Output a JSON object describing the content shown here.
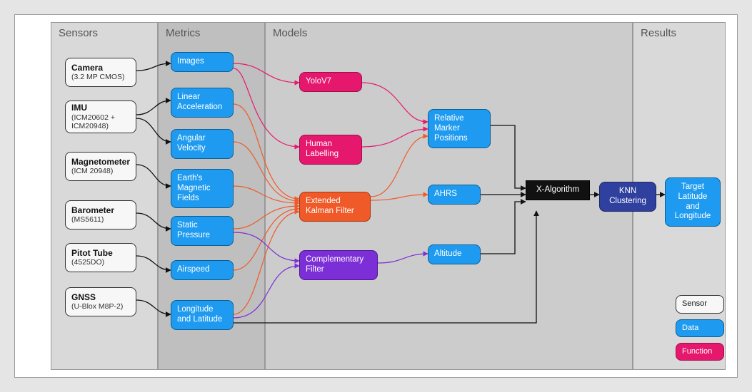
{
  "columns": {
    "sensors": "Sensors",
    "metrics": "Metrics",
    "models": "Models",
    "results": "Results"
  },
  "sensors": [
    {
      "title": "Camera",
      "sub": "(3.2 MP CMOS)"
    },
    {
      "title": "IMU",
      "sub": "(ICM20602 + ICM20948)"
    },
    {
      "title": "Magnetometer",
      "sub": "(ICM 20948)"
    },
    {
      "title": "Barometer",
      "sub": "(MS5611)"
    },
    {
      "title": "Pitot Tube",
      "sub": "(4525DO)"
    },
    {
      "title": "GNSS",
      "sub": "(U-Blox M8P-2)"
    }
  ],
  "metrics": [
    "Images",
    "Linear Acceleration",
    "Angular Velocity",
    "Earth's Magnetic Fields",
    "Static Pressure",
    "Airspeed",
    "Longitude and Latitude"
  ],
  "models": {
    "yolo": "YoloV7",
    "human": "Human Labelling",
    "ekf": "Extended Kalman Filter",
    "comp": "Complementary Filter",
    "rel": "Relative Marker Positions",
    "ahrs": "AHRS",
    "alt": "Altitude",
    "xalg": "X-Algorithm",
    "knn": "KNN Clustering"
  },
  "result": "Target Latitude and Longitude",
  "legend": {
    "sensor": "Sensor",
    "data": "Data",
    "function": "Function"
  },
  "chart_data": {
    "type": "table",
    "title": "Sensor fusion pipeline block diagram",
    "columns": [
      "Sensors",
      "Metrics",
      "Models",
      "Results"
    ],
    "nodes": [
      {
        "id": "camera",
        "label": "Camera (3.2 MP CMOS)",
        "kind": "sensor",
        "column": "Sensors"
      },
      {
        "id": "imu",
        "label": "IMU (ICM20602 + ICM20948)",
        "kind": "sensor",
        "column": "Sensors"
      },
      {
        "id": "mag",
        "label": "Magnetometer (ICM 20948)",
        "kind": "sensor",
        "column": "Sensors"
      },
      {
        "id": "baro",
        "label": "Barometer (MS5611)",
        "kind": "sensor",
        "column": "Sensors"
      },
      {
        "id": "pitot",
        "label": "Pitot Tube (4525DO)",
        "kind": "sensor",
        "column": "Sensors"
      },
      {
        "id": "gnss",
        "label": "GNSS (U-Blox M8P-2)",
        "kind": "sensor",
        "column": "Sensors"
      },
      {
        "id": "images",
        "label": "Images",
        "kind": "data",
        "column": "Metrics"
      },
      {
        "id": "linacc",
        "label": "Linear Acceleration",
        "kind": "data",
        "column": "Metrics"
      },
      {
        "id": "angvel",
        "label": "Angular Velocity",
        "kind": "data",
        "column": "Metrics"
      },
      {
        "id": "magf",
        "label": "Earth's Magnetic Fields",
        "kind": "data",
        "column": "Metrics"
      },
      {
        "id": "spress",
        "label": "Static Pressure",
        "kind": "data",
        "column": "Metrics"
      },
      {
        "id": "airspd",
        "label": "Airspeed",
        "kind": "data",
        "column": "Metrics"
      },
      {
        "id": "lonlat",
        "label": "Longitude and Latitude",
        "kind": "data",
        "column": "Metrics"
      },
      {
        "id": "yolo",
        "label": "YoloV7",
        "kind": "function",
        "column": "Models"
      },
      {
        "id": "human",
        "label": "Human Labelling",
        "kind": "function",
        "column": "Models"
      },
      {
        "id": "ekf",
        "label": "Extended Kalman Filter",
        "kind": "function",
        "column": "Models"
      },
      {
        "id": "comp",
        "label": "Complementary Filter",
        "kind": "function",
        "column": "Models"
      },
      {
        "id": "rel",
        "label": "Relative Marker Positions",
        "kind": "data",
        "column": "Models"
      },
      {
        "id": "ahrs",
        "label": "AHRS",
        "kind": "data",
        "column": "Models"
      },
      {
        "id": "alt",
        "label": "Altitude",
        "kind": "data",
        "column": "Models"
      },
      {
        "id": "xalg",
        "label": "X-Algorithm",
        "kind": "function",
        "column": "Models"
      },
      {
        "id": "knn",
        "label": "KNN Clustering",
        "kind": "function",
        "column": "Models"
      },
      {
        "id": "target",
        "label": "Target Latitude and Longitude",
        "kind": "data",
        "column": "Results"
      }
    ],
    "edges": [
      [
        "camera",
        "images"
      ],
      [
        "imu",
        "linacc"
      ],
      [
        "imu",
        "angvel"
      ],
      [
        "mag",
        "magf"
      ],
      [
        "baro",
        "spress"
      ],
      [
        "pitot",
        "airspd"
      ],
      [
        "gnss",
        "lonlat"
      ],
      [
        "images",
        "yolo"
      ],
      [
        "images",
        "human"
      ],
      [
        "linacc",
        "ekf"
      ],
      [
        "angvel",
        "ekf"
      ],
      [
        "magf",
        "ekf"
      ],
      [
        "spress",
        "ekf"
      ],
      [
        "airspd",
        "ekf"
      ],
      [
        "lonlat",
        "ekf"
      ],
      [
        "spress",
        "comp"
      ],
      [
        "lonlat",
        "comp"
      ],
      [
        "yolo",
        "rel"
      ],
      [
        "human",
        "rel"
      ],
      [
        "ekf",
        "ahrs"
      ],
      [
        "ekf",
        "rel"
      ],
      [
        "comp",
        "alt"
      ],
      [
        "rel",
        "xalg"
      ],
      [
        "ahrs",
        "xalg"
      ],
      [
        "alt",
        "xalg"
      ],
      [
        "lonlat",
        "xalg"
      ],
      [
        "xalg",
        "knn"
      ],
      [
        "knn",
        "target"
      ]
    ],
    "legend": [
      {
        "label": "Sensor",
        "kind": "sensor"
      },
      {
        "label": "Data",
        "kind": "data"
      },
      {
        "label": "Function",
        "kind": "function"
      }
    ]
  }
}
